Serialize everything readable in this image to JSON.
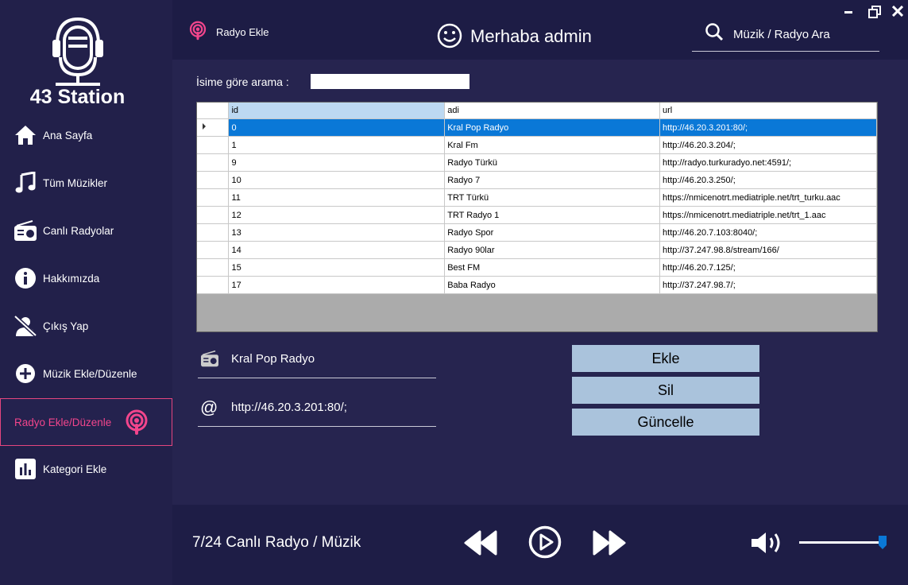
{
  "app": {
    "title": "43 Station"
  },
  "sidebar": {
    "items": [
      {
        "label": "Ana Sayfa",
        "icon": "home-icon"
      },
      {
        "label": "Tüm Müzikler",
        "icon": "music-note-icon"
      },
      {
        "label": "Canlı Radyolar",
        "icon": "radio-icon"
      },
      {
        "label": "Hakkımızda",
        "icon": "info-icon"
      },
      {
        "label": "Çıkış Yap",
        "icon": "user-off-icon"
      },
      {
        "label": "Müzik Ekle/Düzenle",
        "icon": "add-circle-icon"
      },
      {
        "label": "Radyo Ekle/Düzenle",
        "icon": "podcast-icon",
        "active": true
      },
      {
        "label": "Kategori Ekle",
        "icon": "bar-chart-icon"
      }
    ]
  },
  "header": {
    "section_label": "Radyo Ekle",
    "greeting": "Merhaba admin",
    "search_placeholder": "Müzik / Radyo Ara"
  },
  "filter": {
    "label": "İsime göre arama :",
    "value": ""
  },
  "table": {
    "columns": [
      "id",
      "adi",
      "url"
    ],
    "rows": [
      [
        "0",
        "Kral Pop Radyo",
        "http://46.20.3.201:80/;"
      ],
      [
        "1",
        "Kral Fm",
        "http://46.20.3.204/;"
      ],
      [
        "9",
        "Radyo Türkü",
        "http://radyo.turkuradyo.net:4591/;"
      ],
      [
        "10",
        "Radyo 7",
        "http://46.20.3.250/;"
      ],
      [
        "11",
        "TRT Türkü",
        "https://nmicenotrt.mediatriple.net/trt_turku.aac"
      ],
      [
        "12",
        "TRT Radyo 1",
        "https://nmicenotrt.mediatriple.net/trt_1.aac"
      ],
      [
        "13",
        "Radyo Spor",
        "http://46.20.7.103:8040/;"
      ],
      [
        "14",
        "Radyo 90lar",
        "http://37.247.98.8/stream/166/"
      ],
      [
        "15",
        "Best FM",
        "http://46.20.7.125/;"
      ],
      [
        "17",
        "Baba Radyo",
        "http://37.247.98.7/;"
      ]
    ],
    "selected_row": 0
  },
  "form": {
    "name_value": "Kral Pop Radyo",
    "url_value": "http://46.20.3.201:80/;"
  },
  "buttons": {
    "add": "Ekle",
    "delete": "Sil",
    "update": "Güncelle"
  },
  "player": {
    "tagline": "7/24 Canlı Radyo / Müzik",
    "volume": 1.0
  },
  "colors": {
    "accent": "#f2458c",
    "selection": "#0a78d7",
    "button": "#aac3dc"
  }
}
